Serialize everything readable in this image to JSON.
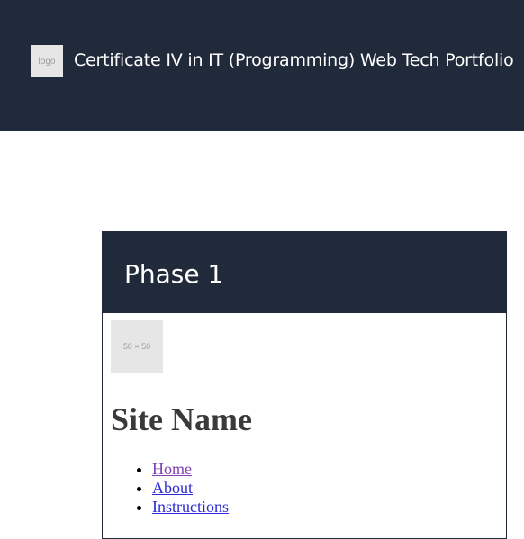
{
  "header": {
    "logo_text": "logo",
    "title": "Certificate IV in IT (Programming) Web Tech Portfolio",
    "background": "#212a3b"
  },
  "card": {
    "title": "Phase 1",
    "image_placeholder": "50 × 50",
    "site_name": "Site Name",
    "nav": [
      {
        "label": "Home",
        "state": "visited"
      },
      {
        "label": "About",
        "state": "unvisited"
      },
      {
        "label": "Instructions",
        "state": "unvisited"
      }
    ]
  },
  "colors": {
    "dark_navy": "#212a3b",
    "visited_link": "#7f40b0",
    "link": "#2c2cd6"
  }
}
